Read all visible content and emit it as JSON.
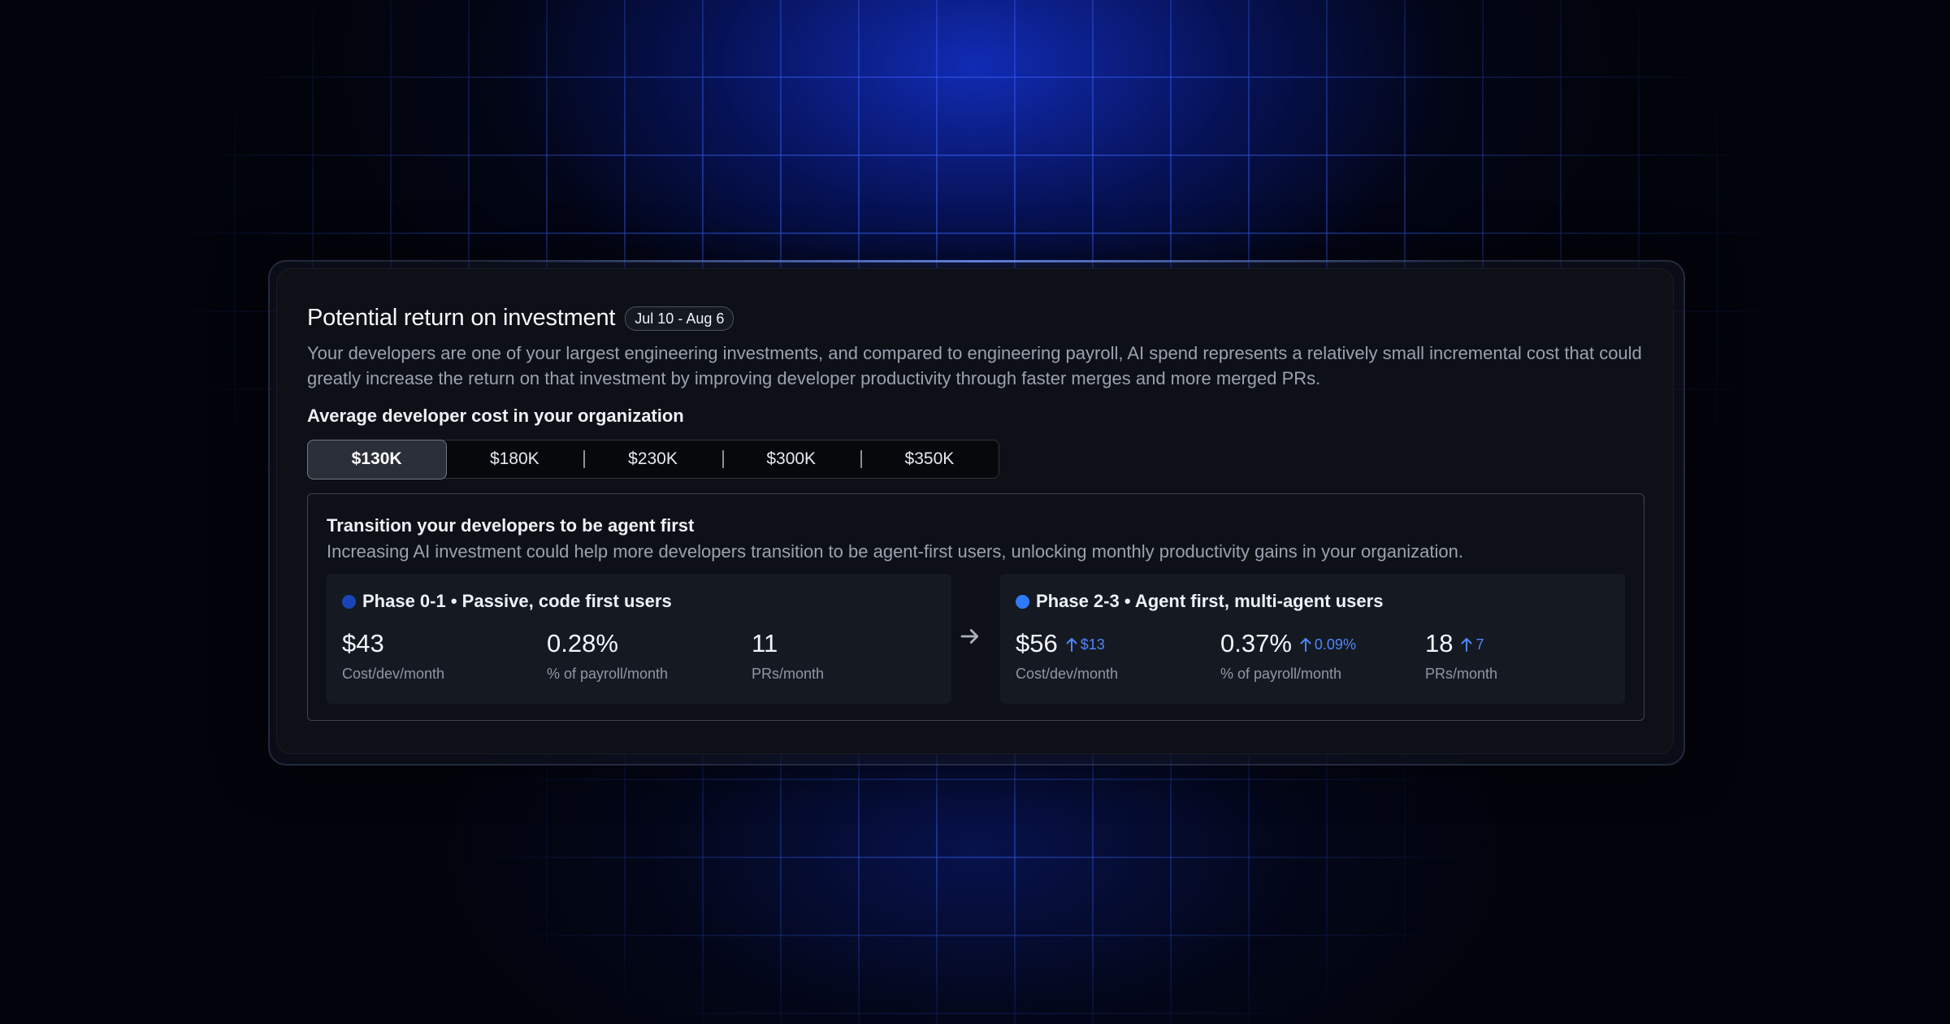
{
  "header": {
    "title": "Potential return on investment",
    "date_range": "Jul 10 - Aug 6",
    "description": "Your developers are one of your largest engineering investments, and compared to engineering payroll, AI spend represents a relatively small incremental cost that could greatly increase the return on that investment by improving developer productivity through faster merges and more merged PRs."
  },
  "cost_selector": {
    "label": "Average developer cost in your organization",
    "options": [
      "$130K",
      "$180K",
      "$230K",
      "$300K",
      "$350K"
    ],
    "selected": "$130K"
  },
  "transition": {
    "title": "Transition your developers to be agent first",
    "description": "Increasing AI investment could help more developers transition to be agent-first users, unlocking monthly productivity gains in your organization.",
    "arrow_icon": "arrow-right-icon",
    "phases": [
      {
        "title": "Phase 0-1 • Passive, code first users",
        "dot_color": "#1846b8",
        "metrics": [
          {
            "value": "$43",
            "label": "Cost/dev/month"
          },
          {
            "value": "0.28%",
            "label": "% of payroll/month"
          },
          {
            "value": "11",
            "label": "PRs/month"
          }
        ]
      },
      {
        "title": "Phase 2-3 • Agent first, multi-agent users",
        "dot_color": "#2f7bff",
        "metrics": [
          {
            "value": "$56",
            "delta": "$13",
            "label": "Cost/dev/month"
          },
          {
            "value": "0.37%",
            "delta": "0.09%",
            "label": "% of payroll/month"
          },
          {
            "value": "18",
            "delta": "7",
            "label": "PRs/month"
          }
        ]
      }
    ]
  },
  "colors": {
    "accent": "#4f86ff",
    "card_background": "#0d1017",
    "phase_background": "#151a22"
  }
}
